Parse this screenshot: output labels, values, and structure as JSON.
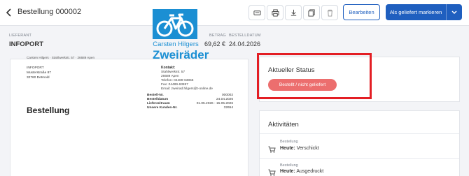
{
  "header": {
    "title": "Bestellung 000002",
    "edit_label": "Bearbeiten",
    "primary_label": "Als geliefert markieren"
  },
  "meta": {
    "supplier_label": "LIEFERANT",
    "supplier_value": "INFOPORT",
    "amount_label": "BETRAG",
    "amount_value": "69,62 €",
    "date_label": "BESTELLDATUM",
    "date_value": "24.04.2026"
  },
  "document": {
    "logo_line1": "Carsten Hilgers",
    "logo_line2": "Zweiräder",
    "sender_line": "Carsten Hilgers · Stahlwerkstr. 57 · 26689 Apen",
    "recipient": [
      "INFOPORT",
      "Musterstraße 87",
      "32760 Detmold"
    ],
    "contact_heading": "Kontakt:",
    "contact_lines": [
      "Stahlwerkstr. 57",
      "26689 Apen",
      "Telefon: 04489-63856",
      "Fax: 04489-63857",
      "Email: zweirad.hilgers@t-online.de"
    ],
    "details": [
      {
        "k": "Bestell-Nr.",
        "v": "000002"
      },
      {
        "k": "Bestelldatum",
        "v": "24.04.2026"
      },
      {
        "k": "Lieferzeitraum",
        "v": "01.05.2026 - 15.05.2026"
      },
      {
        "k": "Unsere Kunden-Nr.",
        "v": "32654"
      }
    ],
    "heading": "Bestellung"
  },
  "status": {
    "heading": "Aktueller Status",
    "pill": "Bestellt / nicht geliefert",
    "pill_color": "#ec6e6e",
    "highlight_color": "#e31e24"
  },
  "activities": {
    "heading": "Aktivitäten",
    "items": [
      {
        "label": "Bestellung",
        "when": "Heute:",
        "text": "Verschickt",
        "icon": "cart-icon"
      },
      {
        "label": "Bestellung",
        "when": "Heute:",
        "text": "Ausgedruckt",
        "icon": "cart-icon"
      }
    ]
  },
  "colors": {
    "accent": "#1f5fbf",
    "logo": "#1b8fd3"
  }
}
